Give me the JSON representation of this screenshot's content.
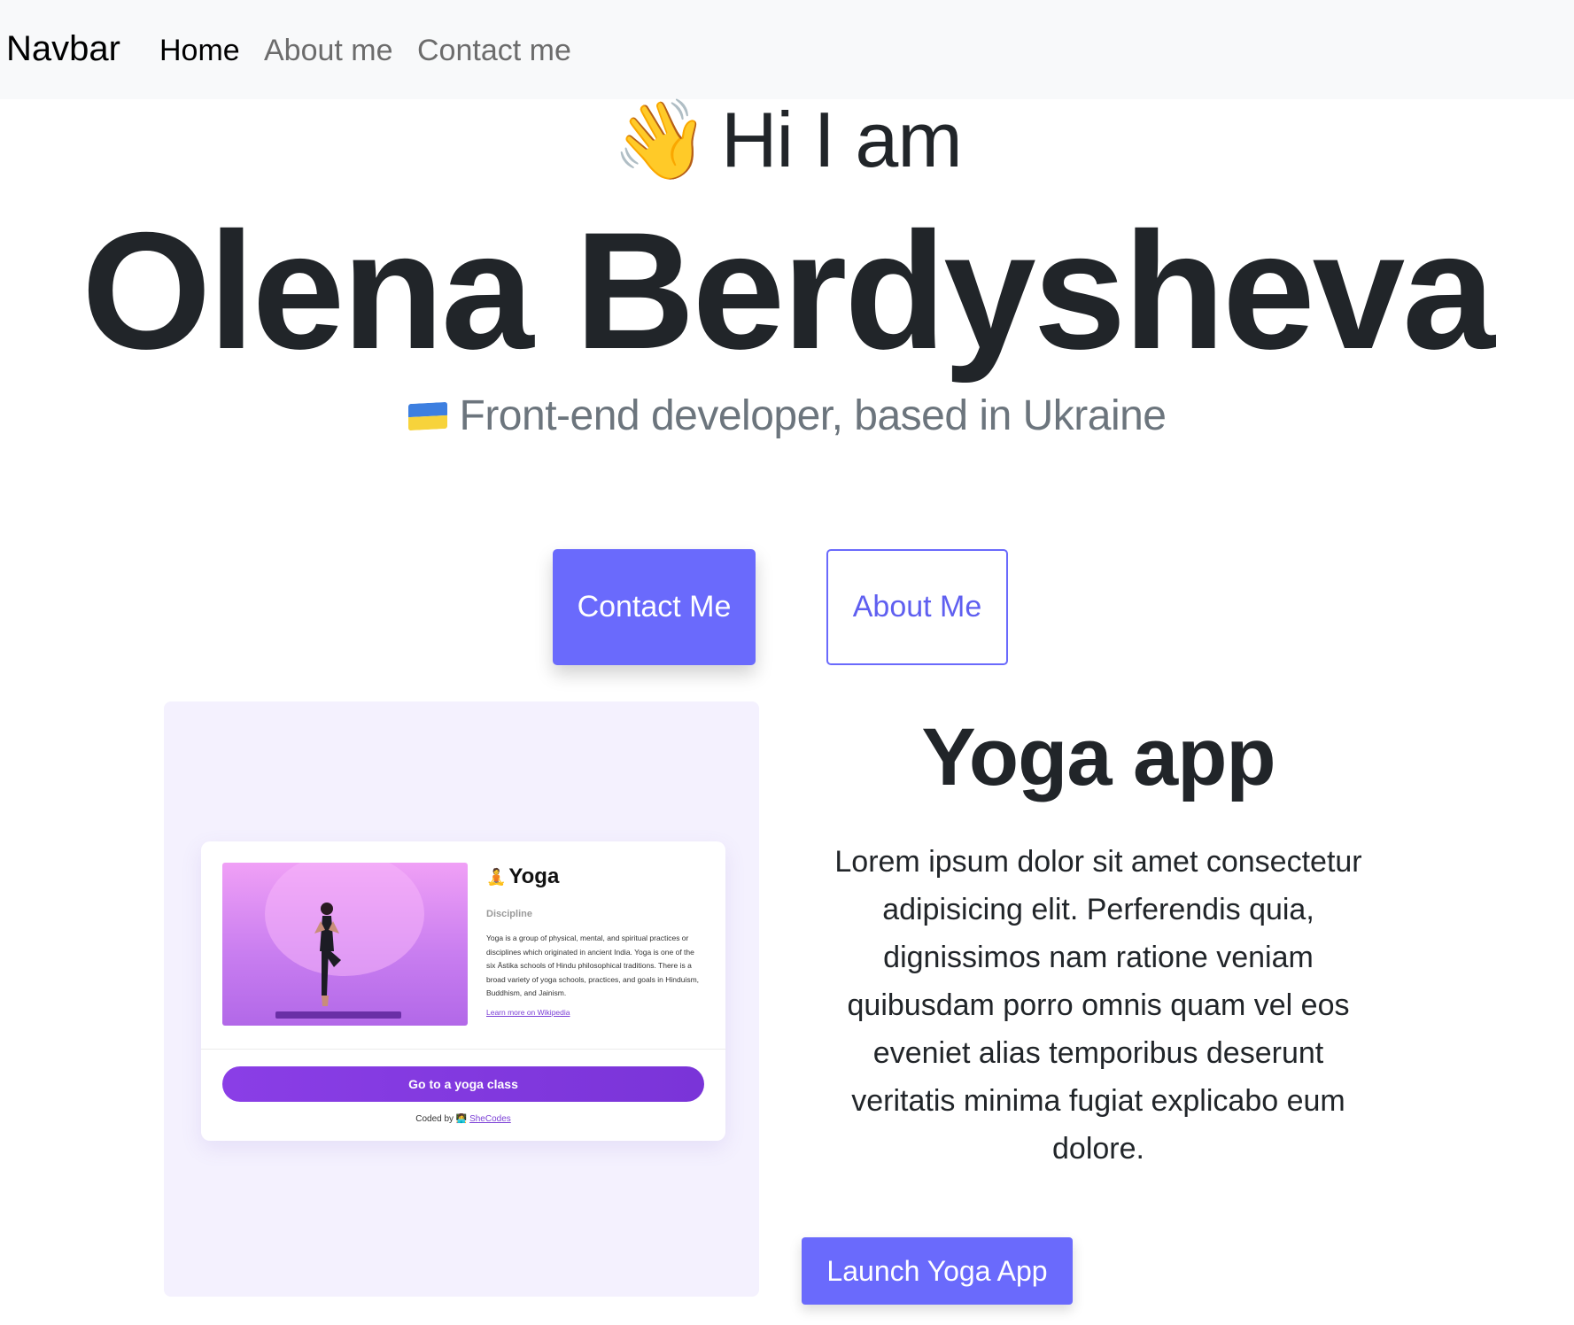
{
  "navbar": {
    "brand": "Navbar",
    "links": [
      {
        "label": "Home",
        "active": true
      },
      {
        "label": "About me",
        "active": false
      },
      {
        "label": "Contact me",
        "active": false
      }
    ]
  },
  "hero": {
    "wave_icon": "waving-hand-icon",
    "greeting": "Hi I am",
    "name": "Olena Berdysheva",
    "flag_icon": "ukraine-flag-icon",
    "role": "Front-end developer, based in Ukraine",
    "contact_button": "Contact Me",
    "about_button": "About Me"
  },
  "project": {
    "title": "Yoga app",
    "description": "Lorem ipsum dolor sit amet consectetur adipisicing elit. Perferendis quia, dignissimos nam ratione veniam quibusdam porro omnis quam vel eos eveniet alias temporibus deserunt veritatis minima fugiat explicabo eum dolore.",
    "launch_button": "Launch Yoga App",
    "preview": {
      "emoji": "🧘",
      "title": "Yoga",
      "subtitle": "Discipline",
      "text": "Yoga is a group of physical, mental, and spiritual practices or disciplines which originated in ancient India. Yoga is one of the six Āstika schools of Hindu philosophical traditions. There is a broad variety of yoga schools, practices, and goals in Hinduism, Buddhism, and Jainism.",
      "link": "Learn more on Wikipedia",
      "button": "Go to a yoga class",
      "footer_prefix": "Coded by",
      "footer_icon": "shecodes-logo-icon",
      "footer_link": "SheCodes"
    }
  },
  "colors": {
    "accent": "#6a6afc",
    "navbar_bg": "#f8f9fa",
    "panel_bg": "#f4f1fe",
    "yoga_purple": "#8a3ee6"
  }
}
